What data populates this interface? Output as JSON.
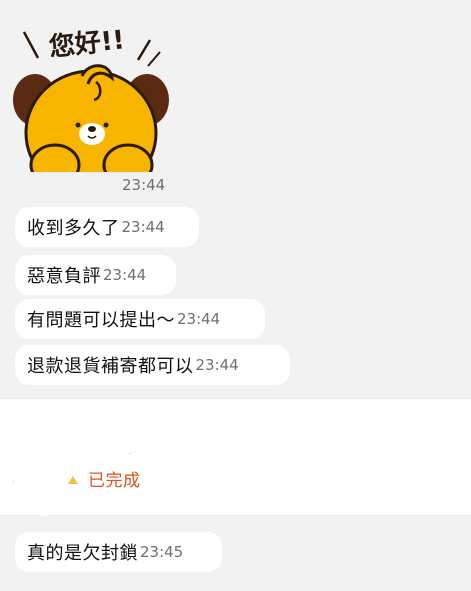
{
  "sticker": {
    "text": "您好!!",
    "time": "23:44",
    "icon": "bear-sticker"
  },
  "messages": [
    {
      "text": "收到多久了",
      "time": "23:44"
    },
    {
      "text": "惡意負評",
      "time": "23:44"
    },
    {
      "text": "有問題可以提出～",
      "time": "23:44"
    },
    {
      "text": "退款退貨補寄都可以",
      "time": "23:44"
    }
  ],
  "order_card": {
    "status": "已完成",
    "status_color": "#e0511c"
  },
  "last_message": {
    "text": "真的是欠封鎖",
    "time": "23:45"
  }
}
